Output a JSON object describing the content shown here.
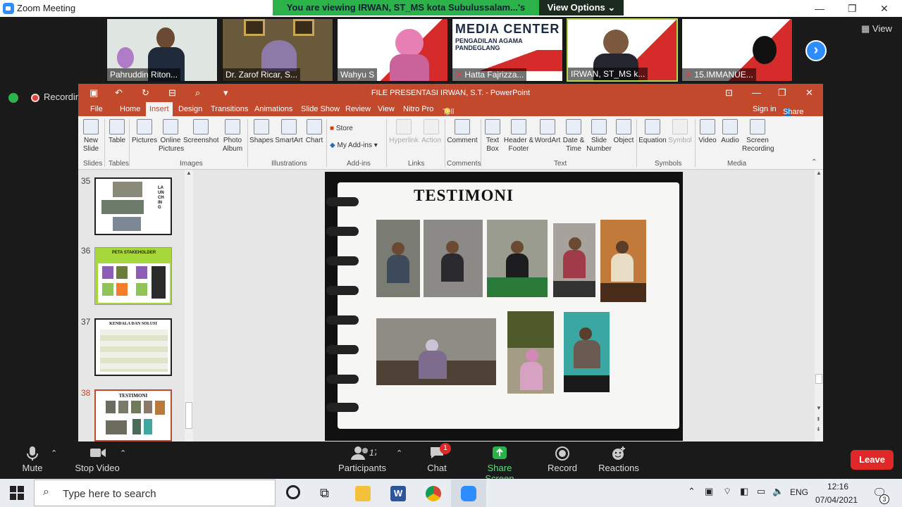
{
  "zoom": {
    "title": "Zoom Meeting",
    "banner": "You are viewing IRWAN, ST_MS kota Subulussalam...'s screen",
    "view_options": "View Options",
    "gallery_view": "View",
    "recording": "Recording",
    "participants": [
      {
        "name": "Pahruddin Riton..."
      },
      {
        "name": "Dr. Zarof Ricar, S..."
      },
      {
        "name": "Wahyu S"
      },
      {
        "name": "Hatta Fajrizza..."
      },
      {
        "name": "IRWAN, ST_MS k..."
      },
      {
        "name": "15.IMMANUE..."
      }
    ],
    "media_center_line1": "MEDIA CENTER",
    "media_center_line2": "PENGADILAN AGAMA PANDEGLANG",
    "toolbar": {
      "mute": "Mute",
      "stop_video": "Stop Video",
      "participants": "Participants",
      "participants_count": "17",
      "chat": "Chat",
      "chat_badge": "1",
      "share_screen": "Share Screen",
      "record": "Record",
      "reactions": "Reactions",
      "leave": "Leave"
    }
  },
  "ppt": {
    "title": "FILE PRESENTASI IRWAN, S.T. - PowerPoint",
    "tabs": [
      "File",
      "Home",
      "Insert",
      "Design",
      "Transitions",
      "Animations",
      "Slide Show",
      "Review",
      "View",
      "Nitro Pro"
    ],
    "tell_me": "Tell me what you want to do...",
    "sign_in": "Sign in",
    "share": "Share",
    "ribbon": {
      "new_slide": "New Slide",
      "table": "Table",
      "pictures": "Pictures",
      "online_pictures": "Online Pictures",
      "screenshot": "Screenshot",
      "photo_album": "Photo Album",
      "shapes": "Shapes",
      "smartart": "SmartArt",
      "chart": "Chart",
      "store": "Store",
      "my_addins": "My Add-ins",
      "hyperlink": "Hyperlink",
      "action": "Action",
      "comment": "Comment",
      "text_box": "Text Box",
      "header_footer": "Header & Footer",
      "wordart": "WordArt",
      "date_time": "Date & Time",
      "slide_number": "Slide Number",
      "object": "Object",
      "equation": "Equation",
      "symbol": "Symbol",
      "video": "Video",
      "audio": "Audio",
      "screen_recording": "Screen Recording",
      "groups": {
        "slides": "Slides",
        "tables": "Tables",
        "images": "Images",
        "illustrations": "Illustrations",
        "addins": "Add-ins",
        "links": "Links",
        "comments": "Comments",
        "text": "Text",
        "symbols": "Symbols",
        "media": "Media"
      }
    },
    "slides": [
      {
        "num": "35",
        "label": "LAUNCHING"
      },
      {
        "num": "36",
        "label": "PETA STAKEHOLDER"
      },
      {
        "num": "37",
        "label": "KENDALA DAN SOLUSI"
      },
      {
        "num": "38",
        "label": "TESTIMONI"
      }
    ],
    "current_slide_title": "TESTIMONI"
  },
  "taskbar": {
    "search_placeholder": "Type here to search",
    "lang": "ENG",
    "time": "12:16",
    "date": "07/04/2021",
    "notifications": "3"
  }
}
